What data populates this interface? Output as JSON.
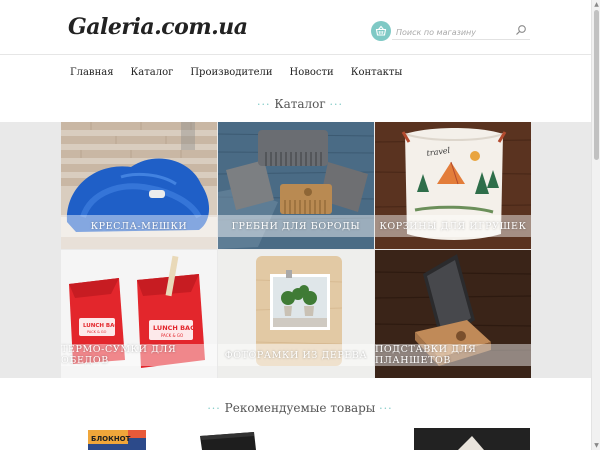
{
  "header": {
    "logo": "Galeria.com.ua",
    "search_placeholder": "Поиск по магазину",
    "icons": {
      "cart": "basket-icon",
      "search": "search-icon"
    },
    "accent_color": "#7fc9c5"
  },
  "nav": {
    "items": [
      {
        "label": "Главная"
      },
      {
        "label": "Каталог"
      },
      {
        "label": "Производители"
      },
      {
        "label": "Новости"
      },
      {
        "label": "Контакты"
      }
    ]
  },
  "catalog": {
    "title": "Каталог",
    "dots_left": "···",
    "dots_right": "···",
    "categories": [
      {
        "label": "КРЕСЛА-МЕШКИ"
      },
      {
        "label": "ГРЕБНИ ДЛЯ БОРОДЫ"
      },
      {
        "label": "КОРЗИНЫ ДЛЯ ИГРУШЕК"
      },
      {
        "label": "ТЕРМО-СУМКИ ДЛЯ ОБЕДОВ"
      },
      {
        "label": "ФОТОРАМКИ ИЗ ДЕРЕВА"
      },
      {
        "label": "ПОДСТАВКИ ДЛЯ ПЛАНШЕТОВ"
      }
    ]
  },
  "recommended": {
    "title": "Рекомендуемые товары",
    "dots_left": "···",
    "dots_right": "···",
    "first_product_text": "БЛОКНОТ"
  }
}
